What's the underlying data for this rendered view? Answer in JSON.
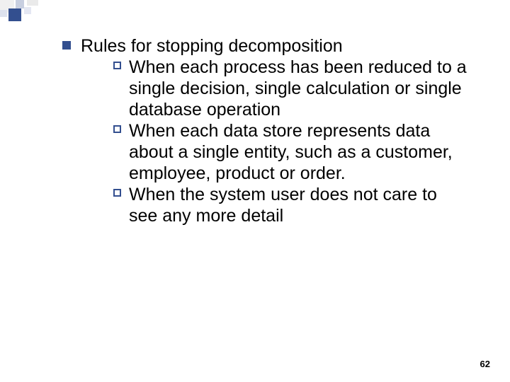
{
  "slide": {
    "heading": "Rules for stopping decomposition",
    "items": [
      "When each process has been reduced to a single decision, single calculation or single database operation",
      "When each data store represents data about a single entity, such as a customer, employee, product  or order.",
      "When the system user does not care to see any more detail"
    ],
    "page_number": "62"
  }
}
